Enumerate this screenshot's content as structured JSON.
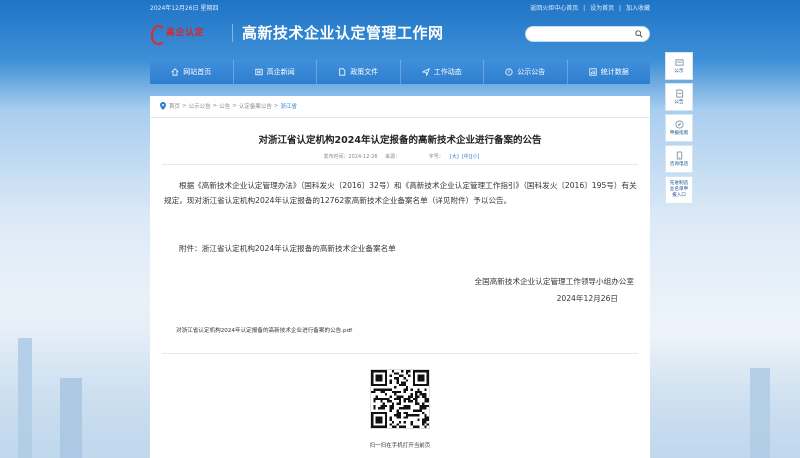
{
  "topbar": {
    "date": "2024年12月26日 星期四",
    "links": [
      "返回火炬中心首页",
      "|",
      "设为首页",
      "|",
      "加入收藏"
    ]
  },
  "header": {
    "logo_text": "高企认定",
    "logo_en": "INNOVATION COMPANY",
    "title": "高新技术企业认定管理工作网"
  },
  "search": {
    "value": "",
    "placeholder": ""
  },
  "nav": [
    {
      "label": "网站首页",
      "icon": "home-icon"
    },
    {
      "label": "高企新闻",
      "icon": "news-icon"
    },
    {
      "label": "政策文件",
      "icon": "document-icon"
    },
    {
      "label": "工作动态",
      "icon": "send-icon"
    },
    {
      "label": "公示公告",
      "icon": "announcement-icon"
    },
    {
      "label": "统计数据",
      "icon": "chart-icon"
    }
  ],
  "breadcrumb": {
    "items": [
      "首页",
      "公示公告",
      "公告",
      "认定备案公告"
    ],
    "separator": ">",
    "current": "浙江省"
  },
  "article": {
    "title": "对浙江省认定机构2024年认定报备的高新技术企业进行备案的公告",
    "meta_date_label": "发布时间：2024-12-26",
    "meta_source_label": "来源：",
    "meta_fontsize_label": "字号：",
    "fs_large": "[大]",
    "fs_medium": "[中]",
    "fs_small": "[小]",
    "paragraph": "根据《高新技术企业认定管理办法》（国科发火〔2016〕32号）和《高新技术企业认定管理工作指引》（国科发火〔2016〕195号）有关规定，现对浙江省认定机构2024年认定报备的12762家高新技术企业备案名单（详见附件）予以公告。",
    "attachment": "附件：浙江省认定机构2024年认定报备的高新技术企业备案名单",
    "sign_org": "全国高新技术企业认定管理工作领导小组办公室",
    "sign_date": "2024年12月26日",
    "pdf_link": "对浙江省认定机构2024年认定报备的高新技术企业进行备案的公告.pdf"
  },
  "qr": {
    "caption": "扫一扫在手机打开当前页"
  },
  "side": [
    {
      "label": "公示",
      "icon": "notice-icon"
    },
    {
      "label": "公告",
      "icon": "announcement-icon"
    },
    {
      "label": "申报指南",
      "icon": "compass-icon"
    },
    {
      "label": "咨询电话",
      "icon": "phone-icon"
    },
    {
      "label": "先进制造业名单申报入口",
      "icon": ""
    }
  ],
  "colors": {
    "nav": "#2f7fd0",
    "accent": "#2f7fd0",
    "logo_red": "#d9262a"
  }
}
